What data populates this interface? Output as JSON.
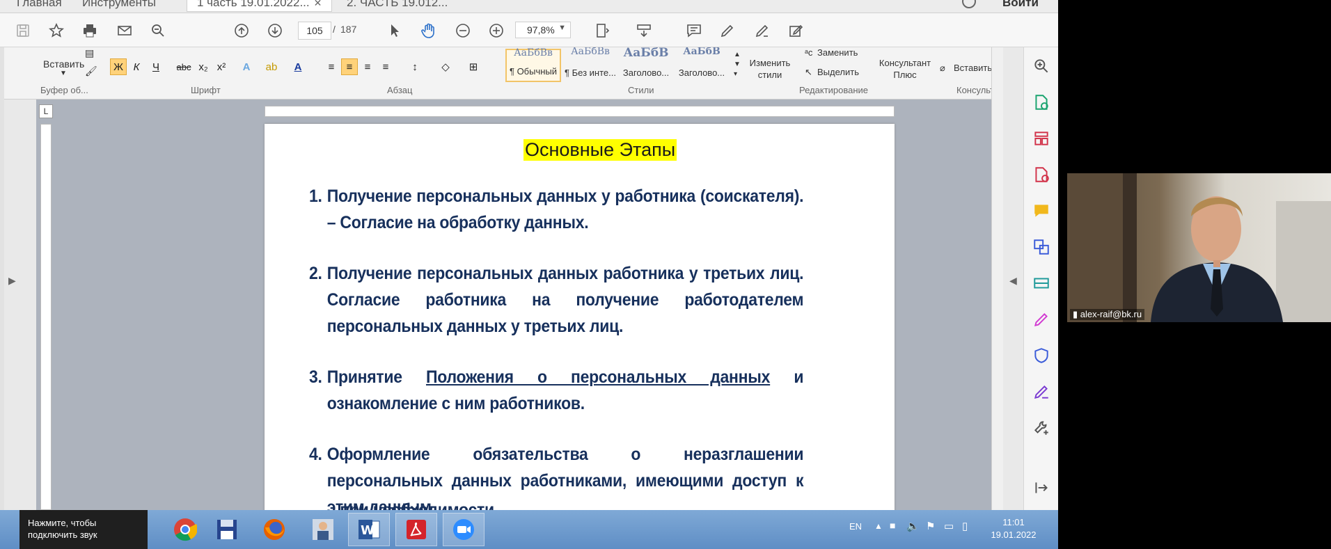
{
  "tabs": [
    {
      "label": "Главная"
    },
    {
      "label": "Инструменты"
    },
    {
      "label": "1 часть 19.01.2022..."
    },
    {
      "label": "2. ЧАСТЬ 19.012..."
    }
  ],
  "login_label": "Войти",
  "toolbar": {
    "page_current": "105",
    "page_separator": "/",
    "page_total": "187",
    "zoom": "97,8%"
  },
  "ribbon": {
    "paste_label": "Вставить",
    "groups": {
      "clipboard": "Буфер об...",
      "font": "Шрифт",
      "paragraph": "Абзац",
      "styles": "Стили",
      "editing": "Редактирование",
      "consultant": "Консульт"
    },
    "format_buttons": [
      "Ж",
      "К",
      "Ч",
      "abc",
      "x₂",
      "x²"
    ],
    "styles": [
      {
        "preview": "АаБбВв",
        "label": "¶ Обычный"
      },
      {
        "preview": "АаБбВв",
        "label": "¶ Без инте..."
      },
      {
        "preview": "АаБбВ",
        "label": "Заголово..."
      },
      {
        "preview": "АаБбВ",
        "label": "Заголово..."
      }
    ],
    "change_styles_label": "Изменить стили",
    "replace_label": "Заменить",
    "select_label": "Выделить",
    "consultant_label": "Консультант Плюс",
    "insert_label": "Вставить"
  },
  "document": {
    "title": "Основные Этапы",
    "items": [
      {
        "num": "1.",
        "text": "Получение персональных данных у работника (соискателя). – Согласие на обработку данных."
      },
      {
        "num": "2.",
        "text": "Получение персональных данных работника у третьих лиц. Согласие работника на получение работодателем персональных данных у третьих лиц."
      },
      {
        "num": "3.",
        "pre": "Принятие ",
        "link": "Положения о персональных данных",
        "post": " и ознакомление с ним работников."
      },
      {
        "num": "4.",
        "text": "Оформление обязательства о неразглашении персональных данных работниками, имеющими доступ к этим данным"
      },
      {
        "num": "",
        "text": "– при необходимости"
      }
    ]
  },
  "taskbar": {
    "sound_popup": [
      "Нажмите, чтобы",
      "подключить звук"
    ],
    "lang": "EN",
    "time": "11:01",
    "date": "19.01.2022"
  },
  "webcam": {
    "participant": "alex-raif@bk.ru"
  },
  "colors": {
    "doc_text": "#17305c",
    "highlight": "#ffff00",
    "taskbar": "#6a97cb"
  }
}
